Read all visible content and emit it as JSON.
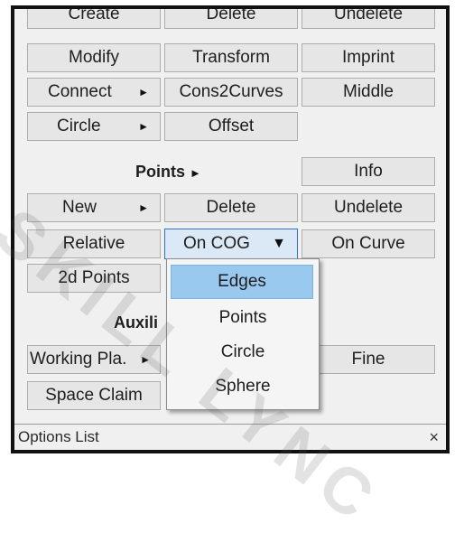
{
  "curves": {
    "row1": [
      "Create",
      "Delete",
      "Undelete"
    ],
    "row2": [
      "Modify",
      "Transform",
      "Imprint"
    ],
    "connect": "Connect",
    "cons2curves": "Cons2Curves",
    "middle": "Middle",
    "circle": "Circle",
    "offset": "Offset"
  },
  "points": {
    "section_label": "Points",
    "info": "Info",
    "new": "New",
    "delete": "Delete",
    "undelete": "Undelete",
    "relative": "Relative",
    "method_select": "On COG",
    "on_curve": "On Curve",
    "points_2d": "2d Points"
  },
  "dropdown": {
    "options": [
      "Edges",
      "Points",
      "Circle",
      "Sphere"
    ],
    "highlighted": "Edges"
  },
  "auxiliary": {
    "section_label": "Auxili",
    "working_plane": "Working Pla.",
    "fine": "Fine",
    "space_claim": "Space Claim"
  },
  "footer": {
    "title": "Options List",
    "close": "×"
  },
  "watermark": "SKILL LYNC",
  "colors": {
    "button_bg": "#e6e6e6",
    "highlight": "#99c9ef",
    "select_border": "#2f6fd0"
  }
}
